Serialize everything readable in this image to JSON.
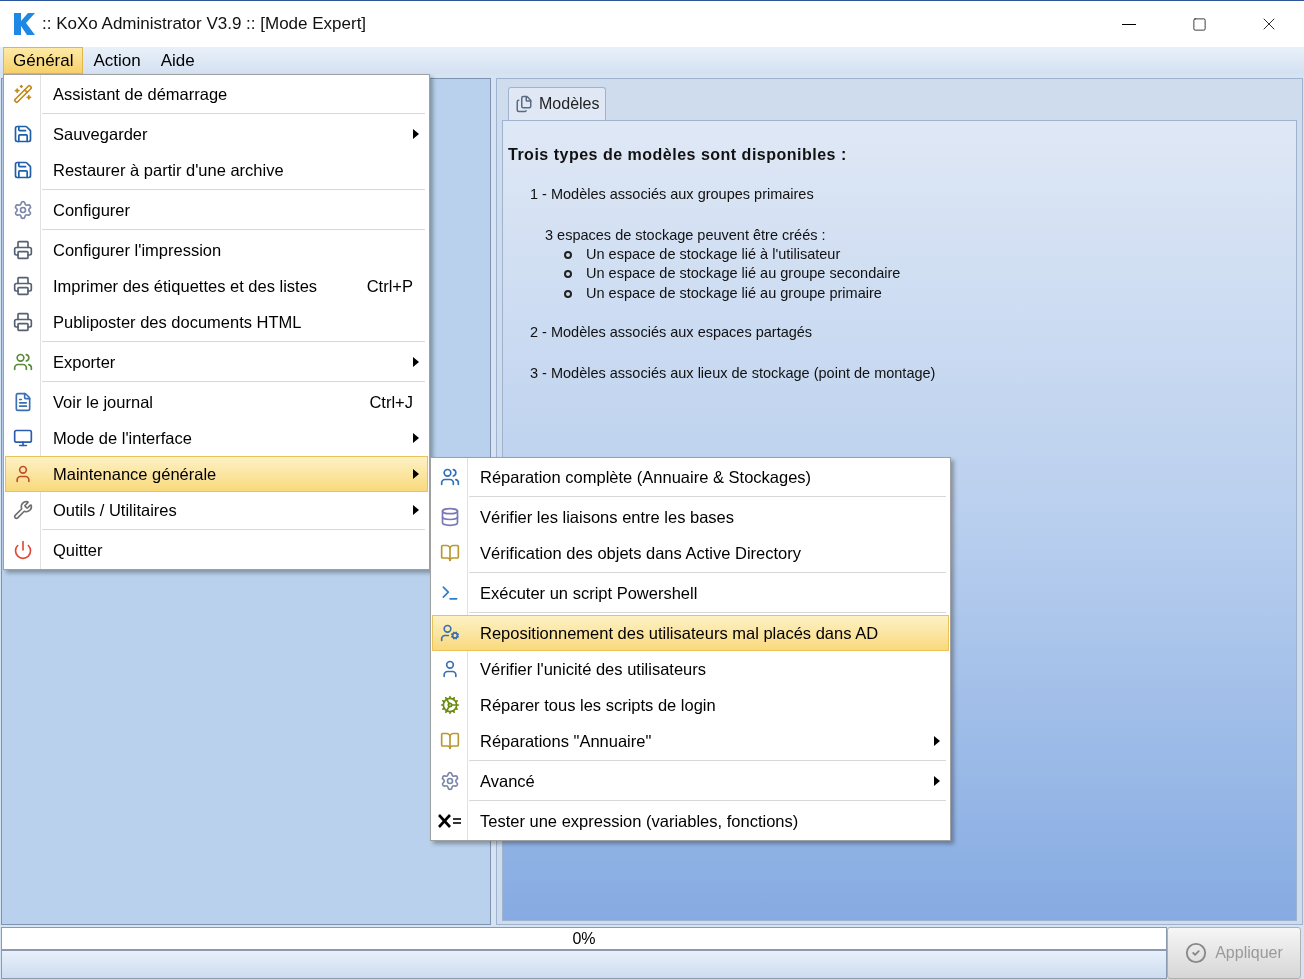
{
  "window": {
    "title": ":: KoXo Administrator V3.9 :: [Mode Expert]"
  },
  "menubar": [
    {
      "label": "Général",
      "selected": true
    },
    {
      "label": "Action",
      "selected": false
    },
    {
      "label": "Aide",
      "selected": false
    }
  ],
  "general_menu": [
    {
      "label": "Assistant de démarrage",
      "submenu": false,
      "separator_after": true,
      "selected": false
    },
    {
      "label": "Sauvegarder",
      "submenu": true,
      "separator_after": false,
      "selected": false
    },
    {
      "label": "Restaurer à partir d'une archive",
      "submenu": false,
      "separator_after": true,
      "selected": false
    },
    {
      "label": "Configurer",
      "submenu": false,
      "separator_after": true,
      "selected": false
    },
    {
      "label": "Configurer l'impression",
      "submenu": false,
      "separator_after": false,
      "selected": false
    },
    {
      "label": "Imprimer des étiquettes et des listes",
      "shortcut": "Ctrl+P",
      "submenu": false,
      "separator_after": false,
      "selected": false
    },
    {
      "label": "Publiposter des documents HTML",
      "submenu": false,
      "separator_after": true,
      "selected": false
    },
    {
      "label": "Exporter",
      "submenu": true,
      "separator_after": true,
      "selected": false
    },
    {
      "label": "Voir le journal",
      "shortcut": "Ctrl+J",
      "submenu": false,
      "separator_after": false,
      "selected": false
    },
    {
      "label": "Mode de l'interface",
      "submenu": true,
      "separator_after": false,
      "selected": false
    },
    {
      "label": "Maintenance générale",
      "submenu": true,
      "separator_after": false,
      "selected": true
    },
    {
      "label": "Outils / Utilitaires",
      "submenu": true,
      "separator_after": true,
      "selected": false
    },
    {
      "label": "Quitter",
      "submenu": false,
      "separator_after": false,
      "selected": false
    }
  ],
  "maintenance_submenu": [
    {
      "label": "Réparation complète (Annuaire & Stockages)",
      "submenu": false,
      "separator_after": true,
      "selected": false
    },
    {
      "label": "Vérifier les liaisons entre les bases",
      "submenu": false,
      "separator_after": false,
      "selected": false
    },
    {
      "label": "Vérification des objets dans Active Directory",
      "submenu": false,
      "separator_after": true,
      "selected": false
    },
    {
      "label": "Exécuter un script Powershell",
      "submenu": false,
      "separator_after": true,
      "selected": false
    },
    {
      "label": "Repositionnement des utilisateurs mal placés dans AD",
      "submenu": false,
      "separator_after": false,
      "selected": true
    },
    {
      "label": "Vérifier l'unicité des utilisateurs",
      "submenu": false,
      "separator_after": false,
      "selected": false
    },
    {
      "label": "Réparer tous les scripts de login",
      "submenu": false,
      "separator_after": false,
      "selected": false
    },
    {
      "label": "Réparations \"Annuaire\"",
      "submenu": true,
      "separator_after": true,
      "selected": false
    },
    {
      "label": "Avancé",
      "submenu": true,
      "separator_after": true,
      "selected": false
    },
    {
      "label": "Tester une expression (variables, fonctions)",
      "submenu": false,
      "separator_after": false,
      "selected": false
    }
  ],
  "tabs": [
    {
      "label": "Modèles",
      "selected": true
    }
  ],
  "content": {
    "heading": "Trois types de modèles sont disponibles :",
    "paragraphs": [
      {
        "kind": "numbered",
        "text": "1 - Modèles associés aux groupes primaires"
      },
      {
        "kind": "note",
        "text": "3 espaces de stockage peuvent être créés :"
      },
      {
        "kind": "bullet",
        "text": "Un espace de stockage lié à l'utilisateur"
      },
      {
        "kind": "bullet",
        "text": "Un espace de stockage lié au groupe secondaire"
      },
      {
        "kind": "bullet",
        "text": "Un espace de stockage lié au groupe primaire"
      },
      {
        "kind": "numbered",
        "text": "2 - Modèles associés aux espaces partagés"
      },
      {
        "kind": "numbered",
        "text": "3 - Modèles associés aux lieux de stockage (point de montage)"
      }
    ]
  },
  "progress": {
    "text": "0%",
    "level": 0
  },
  "apply_button": {
    "label": "Appliquer",
    "disabled": true
  }
}
